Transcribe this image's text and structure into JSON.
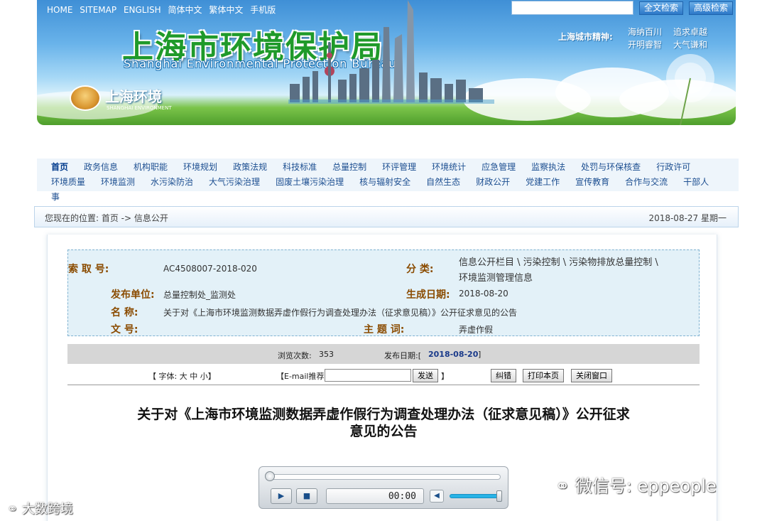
{
  "topnav": {
    "links": [
      "HOME",
      "SITEMAP",
      "ENGLISH",
      "简体中文",
      "繁体中文",
      "手机版"
    ],
    "search_placeholder": "",
    "fulltext_search": "全文检索",
    "advanced_search": "高级检索"
  },
  "banner": {
    "title_cn": "上海市环境保护局",
    "title_en": "Shanghai Environmental Protection Bureau",
    "logo_cn": "上海环境",
    "logo_en": "SHANGHAI ENVIRONMENT",
    "spirit_label": "上海城市精神:",
    "spirit_1a": "海纳百川",
    "spirit_1b": "追求卓越",
    "spirit_2a": "开明睿智",
    "spirit_2b": "大气谦和"
  },
  "mainnav": {
    "row1": [
      "首页",
      "政务信息",
      "机构职能",
      "环境规划",
      "政策法规",
      "科技标准",
      "总量控制",
      "环评管理",
      "环境统计",
      "应急管理",
      "监察执法",
      "处罚与环保核查",
      "行政许可"
    ],
    "row2": [
      "环境质量",
      "环境监测",
      "水污染防治",
      "大气污染治理",
      "固废土壤污染治理",
      "核与辐射安全",
      "自然生态",
      "财政公开",
      "党建工作",
      "宣传教育",
      "合作与交流",
      "干部人"
    ],
    "overflow": "事"
  },
  "breadcrumb": {
    "text": "您现在的位置: 首页 -> 信息公开",
    "date": "2018-08-27 星期一"
  },
  "meta": {
    "index_label": "索    取    号:",
    "index_value": "AC4508007-2018-020",
    "category_label": "分    类:",
    "category_value_1": "信息公开栏目 \\ 污染控制 \\ 污染物排放总量控制 \\",
    "category_value_2": "环境监测管理信息",
    "publisher_label": "发布单位:",
    "publisher_value": "总量控制处_监测处",
    "created_label": "生成日期:",
    "created_value": "2018-08-20",
    "name_label": "名    称:",
    "name_value": "关于对《上海市环境监测数据弄虚作假行为调查处理办法（征求意见稿）》公开征求意见的公告",
    "docno_label": "文    号:",
    "docno_value": "",
    "keyword_label": "主    题    词:",
    "keyword_value": "弄虚作假"
  },
  "stats": {
    "views_label": "浏览次数:",
    "views": "353",
    "pubdate_label": "发布日期:[",
    "pubdate": "2018-08-20",
    "pubdate_close": "]"
  },
  "tools": {
    "font": "【 字体: 大   中   小】",
    "email_label": "【E-mail推荐",
    "send": "发送",
    "email_close": "】",
    "correct": "纠错",
    "print": "打印本页",
    "close": "关闭窗口"
  },
  "article": {
    "title": "关于对《上海市环境监测数据弄虚作假行为调查处理办法（征求意见稿）》公开征求意见的公告"
  },
  "player": {
    "time": "00:00",
    "progress": 0,
    "volume": 1
  },
  "watermarks": {
    "right": "微信号: eppeople",
    "left": "大数跨境"
  }
}
